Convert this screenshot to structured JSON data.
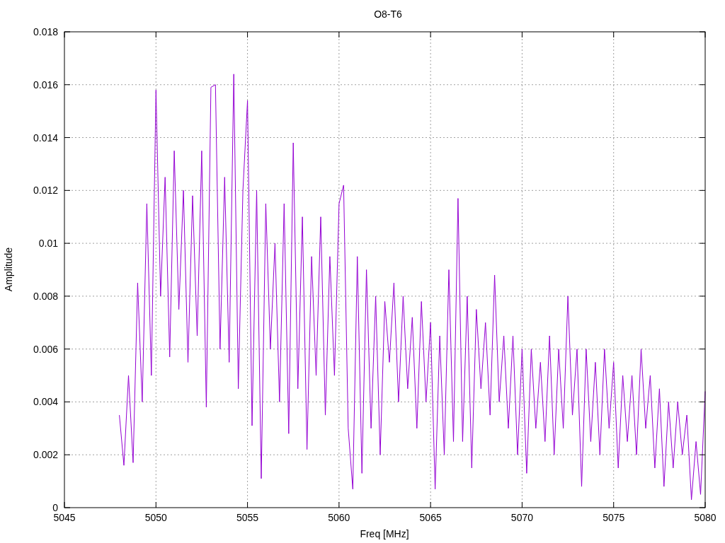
{
  "chart_data": {
    "type": "line",
    "title": "O8-T6",
    "xlabel": "Freq [MHz]",
    "ylabel": "Amplitude",
    "xlim": [
      5045,
      5080
    ],
    "ylim": [
      0,
      0.018
    ],
    "grid": true,
    "xticks": [
      5045,
      5050,
      5055,
      5060,
      5065,
      5070,
      5075,
      5080
    ],
    "yticks": [
      0,
      0.002,
      0.004,
      0.006,
      0.008,
      0.01,
      0.012,
      0.014,
      0.016,
      0.018
    ],
    "x": [
      5048,
      5048.25,
      5048.5,
      5048.75,
      5049,
      5049.25,
      5049.5,
      5049.75,
      5050,
      5050.25,
      5050.5,
      5050.75,
      5051,
      5051.25,
      5051.5,
      5051.75,
      5052,
      5052.25,
      5052.5,
      5052.75,
      5053,
      5053.25,
      5053.5,
      5053.75,
      5054,
      5054.25,
      5054.5,
      5054.75,
      5055,
      5055.25,
      5055.5,
      5055.75,
      5056,
      5056.25,
      5056.5,
      5056.75,
      5057,
      5057.25,
      5057.5,
      5057.75,
      5058,
      5058.25,
      5058.5,
      5058.75,
      5059,
      5059.25,
      5059.5,
      5059.75,
      5060,
      5060.25,
      5060.5,
      5060.75,
      5061,
      5061.25,
      5061.5,
      5061.75,
      5062,
      5062.25,
      5062.5,
      5062.75,
      5063,
      5063.25,
      5063.5,
      5063.75,
      5064,
      5064.25,
      5064.5,
      5064.75,
      5065,
      5065.25,
      5065.5,
      5065.75,
      5066,
      5066.25,
      5066.5,
      5066.75,
      5067,
      5067.25,
      5067.5,
      5067.75,
      5068,
      5068.25,
      5068.5,
      5068.75,
      5069,
      5069.25,
      5069.5,
      5069.75,
      5070,
      5070.25,
      5070.5,
      5070.75,
      5071,
      5071.25,
      5071.5,
      5071.75,
      5072,
      5072.25,
      5072.5,
      5072.75,
      5073,
      5073.25,
      5073.5,
      5073.75,
      5074,
      5074.25,
      5074.5,
      5074.75,
      5075,
      5075.25,
      5075.5,
      5075.75,
      5076,
      5076.25,
      5076.5,
      5076.75,
      5077,
      5077.25,
      5077.5,
      5077.75,
      5078,
      5078.25,
      5078.5,
      5078.75,
      5079,
      5079.25,
      5079.5,
      5079.75,
      5080
    ],
    "series": [
      {
        "color": "#9400d3",
        "values": [
          0.0035,
          0.0016,
          0.005,
          0.0017,
          0.0085,
          0.004,
          0.0115,
          0.005,
          0.0158,
          0.008,
          0.0125,
          0.0057,
          0.0135,
          0.0075,
          0.012,
          0.0055,
          0.0118,
          0.0065,
          0.0135,
          0.0038,
          0.0159,
          0.016,
          0.006,
          0.0125,
          0.0055,
          0.0164,
          0.0045,
          0.012,
          0.0154,
          0.0031,
          0.012,
          0.0011,
          0.0115,
          0.006,
          0.01,
          0.004,
          0.0115,
          0.0028,
          0.0138,
          0.0045,
          0.011,
          0.0022,
          0.0095,
          0.005,
          0.011,
          0.0035,
          0.0095,
          0.005,
          0.0115,
          0.0122,
          0.003,
          0.0007,
          0.0095,
          0.0013,
          0.009,
          0.003,
          0.008,
          0.002,
          0.0078,
          0.0055,
          0.0085,
          0.004,
          0.008,
          0.0045,
          0.0072,
          0.003,
          0.0078,
          0.004,
          0.007,
          0.0007,
          0.0065,
          0.002,
          0.009,
          0.0025,
          0.0117,
          0.0025,
          0.008,
          0.0015,
          0.0075,
          0.0045,
          0.007,
          0.0035,
          0.0088,
          0.004,
          0.0065,
          0.003,
          0.0065,
          0.002,
          0.006,
          0.0013,
          0.006,
          0.003,
          0.0055,
          0.0025,
          0.0065,
          0.002,
          0.006,
          0.003,
          0.008,
          0.0035,
          0.006,
          0.0008,
          0.006,
          0.0025,
          0.0055,
          0.002,
          0.006,
          0.003,
          0.0055,
          0.0015,
          0.005,
          0.0025,
          0.005,
          0.002,
          0.006,
          0.003,
          0.005,
          0.0015,
          0.0045,
          0.0008,
          0.004,
          0.0015,
          0.004,
          0.002,
          0.0035,
          0.0003,
          0.0025,
          0.0005,
          0.0044
        ]
      }
    ]
  }
}
